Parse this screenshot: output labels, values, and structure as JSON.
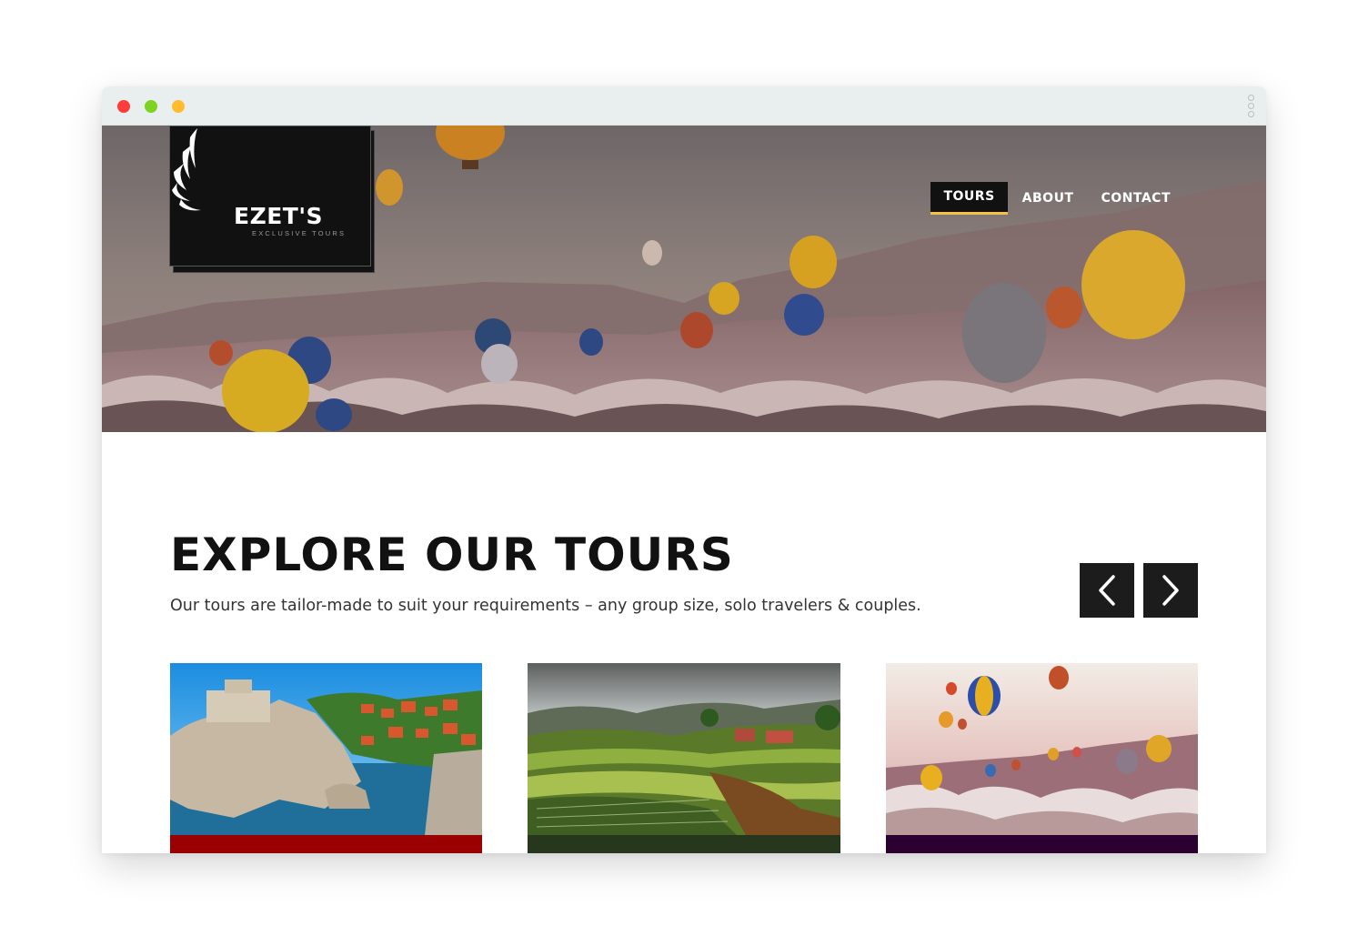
{
  "window": {
    "controls": [
      "close",
      "minimize",
      "maximize"
    ]
  },
  "brand": {
    "name": "EZET'S",
    "tagline": "EXCLUSIVE TOURS"
  },
  "nav": {
    "items": [
      {
        "label": "TOURS",
        "active": true
      },
      {
        "label": "ABOUT",
        "active": false
      },
      {
        "label": "CONTACT",
        "active": false
      }
    ],
    "active_underline_color": "#f5c242"
  },
  "main": {
    "title": "EXPLORE OUR TOURS",
    "subtitle": "Our tours are tailor-made to suit your requirements – any group size, solo travelers & couples.",
    "carousel": {
      "prev_icon": "chevron-left-icon",
      "next_icon": "chevron-right-icon"
    }
  },
  "tours": [
    {
      "image": "coastal-fortress-cliffs",
      "accent_color": "#9a0000"
    },
    {
      "image": "rice-terraces-valley",
      "accent_color": "#27371e"
    },
    {
      "image": "hot-air-balloons-canyon",
      "accent_color": "#2b0030"
    }
  ]
}
